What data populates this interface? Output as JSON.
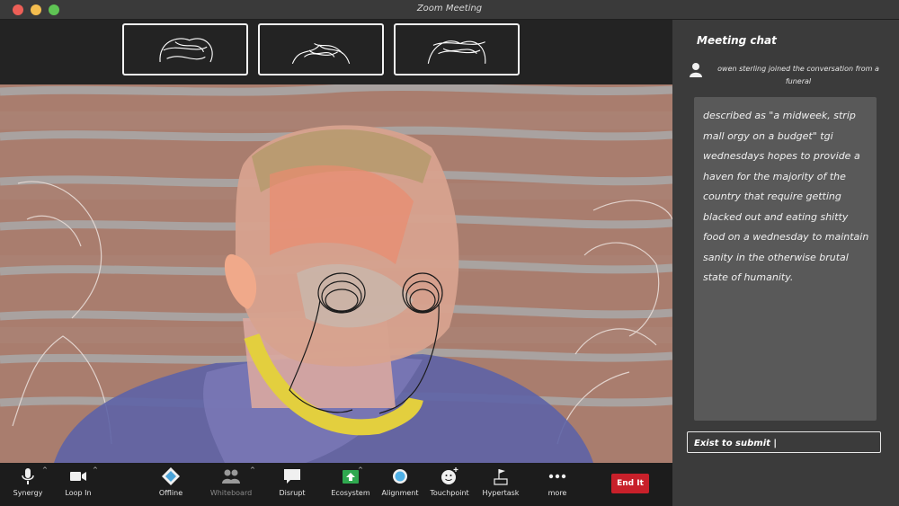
{
  "window": {
    "title": "Zoom Meeting"
  },
  "chat": {
    "title": "Meeting chat",
    "join_notice": "owen sterling  joined the conversation from a funeral",
    "message": "described as \"a midweek, strip mall orgy on a budget\" tgi wednesdays hopes to provide a haven for the majority of the country that require getting blacked out and eating shitty food on a wednesday to maintain sanity in the otherwise brutal state of humanity.",
    "input_placeholder": "Exist to submit |"
  },
  "toolbar": {
    "synergy": "Synergy",
    "loop_in": "Loop In",
    "offline": "Offline",
    "whiteboard": "Whiteboard",
    "disrupt": "Disrupt",
    "ecosystem": "Ecosystem",
    "alignment": "Alignment",
    "touchpoint": "Touchpoint",
    "hypertask": "Hypertask",
    "more": "more",
    "end": "End It"
  },
  "colors": {
    "end_button": "#c8202a",
    "ecosystem_icon": "#2fa84f",
    "alignment_icon": "#4fb0e6"
  },
  "icons": [
    "microphone-icon",
    "camera-icon",
    "diamond-icon",
    "people-icon",
    "speech-bubble-icon",
    "share-up-icon",
    "circle-icon",
    "smiley-plus-icon",
    "flag-icon",
    "ellipsis-icon",
    "user-icon"
  ]
}
